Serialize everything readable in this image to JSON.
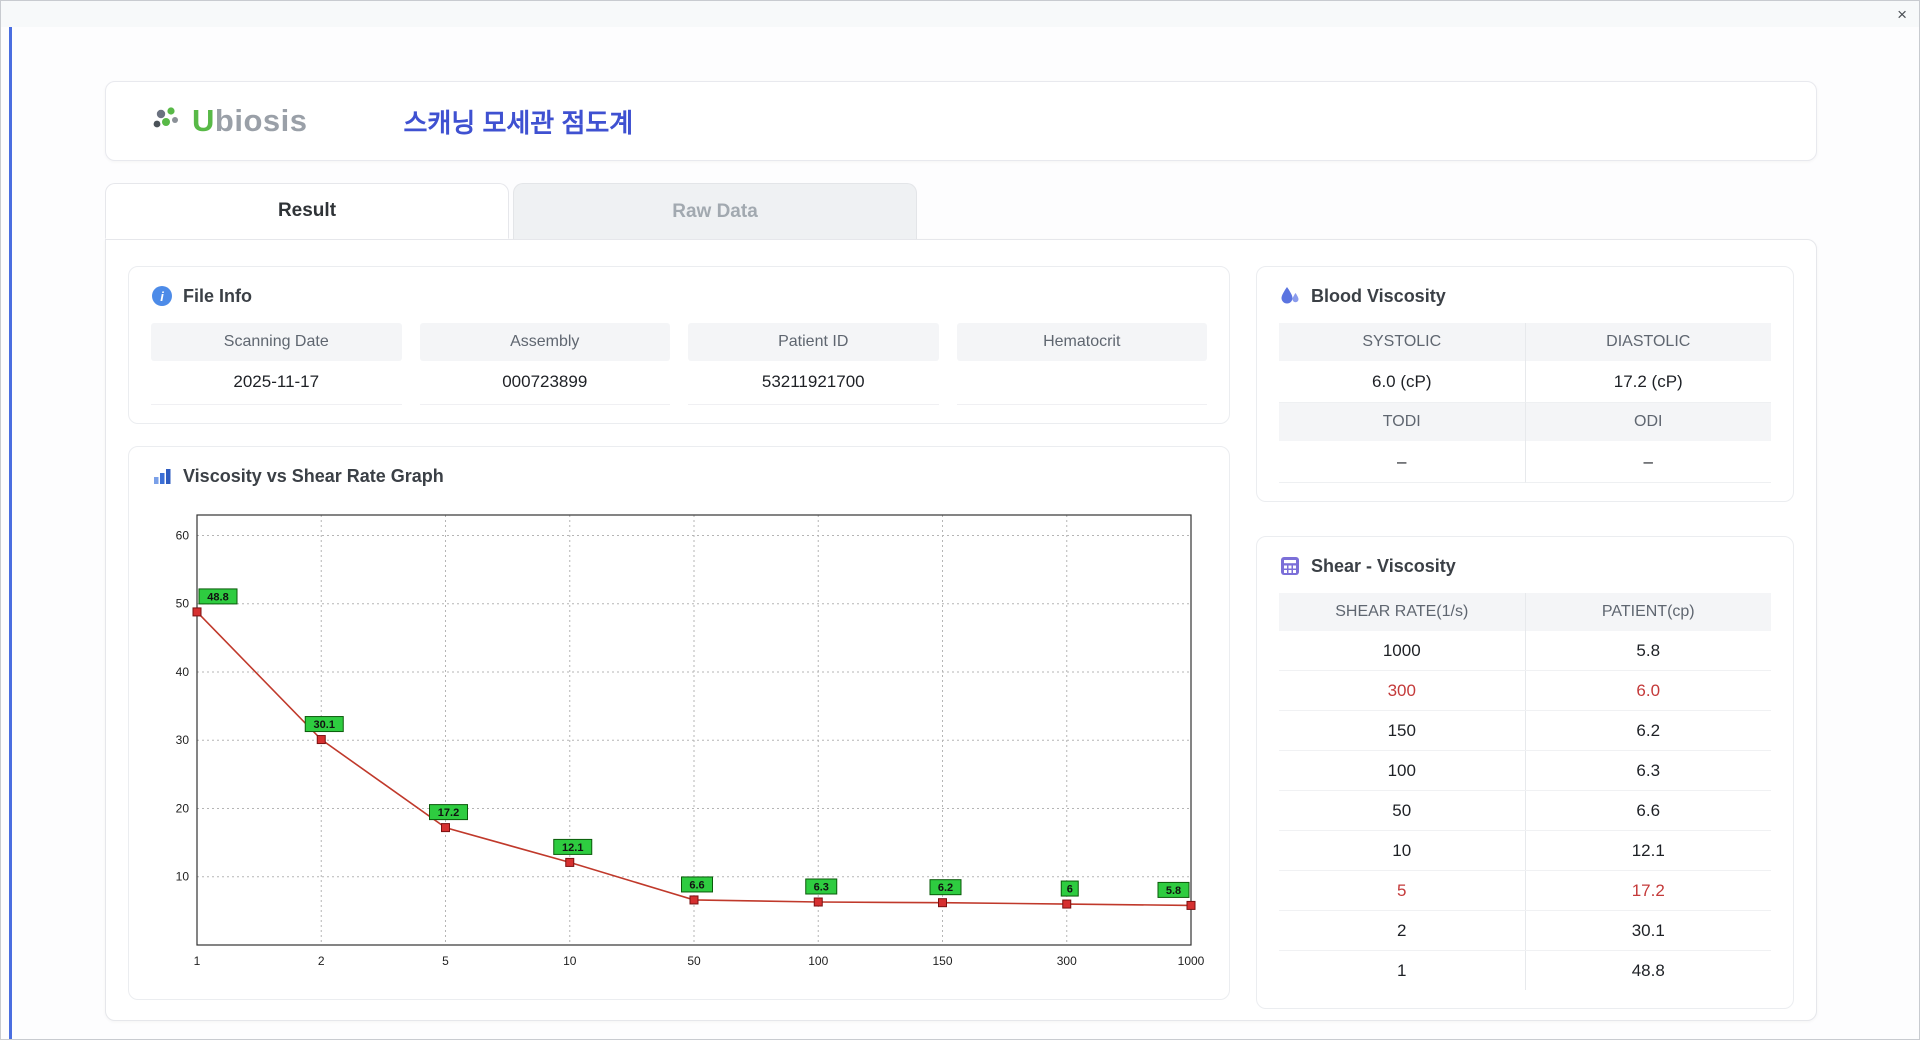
{
  "window": {
    "close": "×"
  },
  "header": {
    "logo_u": "U",
    "logo_rest": "biosis",
    "title": "스캐닝 모세관 점도계"
  },
  "tabs": [
    {
      "label": "Result",
      "active": true
    },
    {
      "label": "Raw Data",
      "active": false
    }
  ],
  "file_info": {
    "title": "File Info",
    "fields": [
      {
        "label": "Scanning Date",
        "value": "2025-11-17"
      },
      {
        "label": "Assembly",
        "value": "000723899"
      },
      {
        "label": "Patient ID",
        "value": "53211921700"
      },
      {
        "label": "Hematocrit",
        "value": ""
      }
    ]
  },
  "blood_viscosity": {
    "title": "Blood Viscosity",
    "rows": [
      {
        "label1": "SYSTOLIC",
        "label2": "DIASTOLIC",
        "value1": "6.0 (cP)",
        "value2": "17.2 (cP)"
      },
      {
        "label1": "TODI",
        "label2": "ODI",
        "value1": "–",
        "value2": "–"
      }
    ]
  },
  "shear_viscosity": {
    "title": "Shear - Viscosity",
    "columns": [
      "SHEAR RATE(1/s)",
      "PATIENT(cp)"
    ],
    "rows": [
      {
        "shear": "1000",
        "patient": "5.8",
        "highlight": false
      },
      {
        "shear": "300",
        "patient": "6.0",
        "highlight": true
      },
      {
        "shear": "150",
        "patient": "6.2",
        "highlight": false
      },
      {
        "shear": "100",
        "patient": "6.3",
        "highlight": false
      },
      {
        "shear": "50",
        "patient": "6.6",
        "highlight": false
      },
      {
        "shear": "10",
        "patient": "12.1",
        "highlight": false
      },
      {
        "shear": "5",
        "patient": "17.2",
        "highlight": true
      },
      {
        "shear": "2",
        "patient": "30.1",
        "highlight": false
      },
      {
        "shear": "1",
        "patient": "48.8",
        "highlight": false
      }
    ]
  },
  "chart_data": {
    "type": "line",
    "title": "Viscosity vs Shear Rate Graph",
    "x": [
      1,
      2,
      5,
      10,
      50,
      100,
      150,
      300,
      1000
    ],
    "values": [
      48.8,
      30.1,
      17.2,
      12.1,
      6.6,
      6.3,
      6.2,
      6.0,
      5.8
    ],
    "point_labels": [
      "48.8",
      "30.1",
      "17.2",
      "12.1",
      "6.6",
      "6.3",
      "6.2",
      "6",
      "5.8"
    ],
    "x_scale": "categorical",
    "yticks": [
      10,
      20,
      30,
      40,
      50,
      60
    ],
    "ylim": [
      0,
      63
    ],
    "grid": "dotted",
    "line_color": "#c0392b",
    "marker_color": "#d63030",
    "marker_edge": "#7a1010",
    "label_bg": "#2ecc40",
    "label_edge": "#0a5a0a"
  }
}
